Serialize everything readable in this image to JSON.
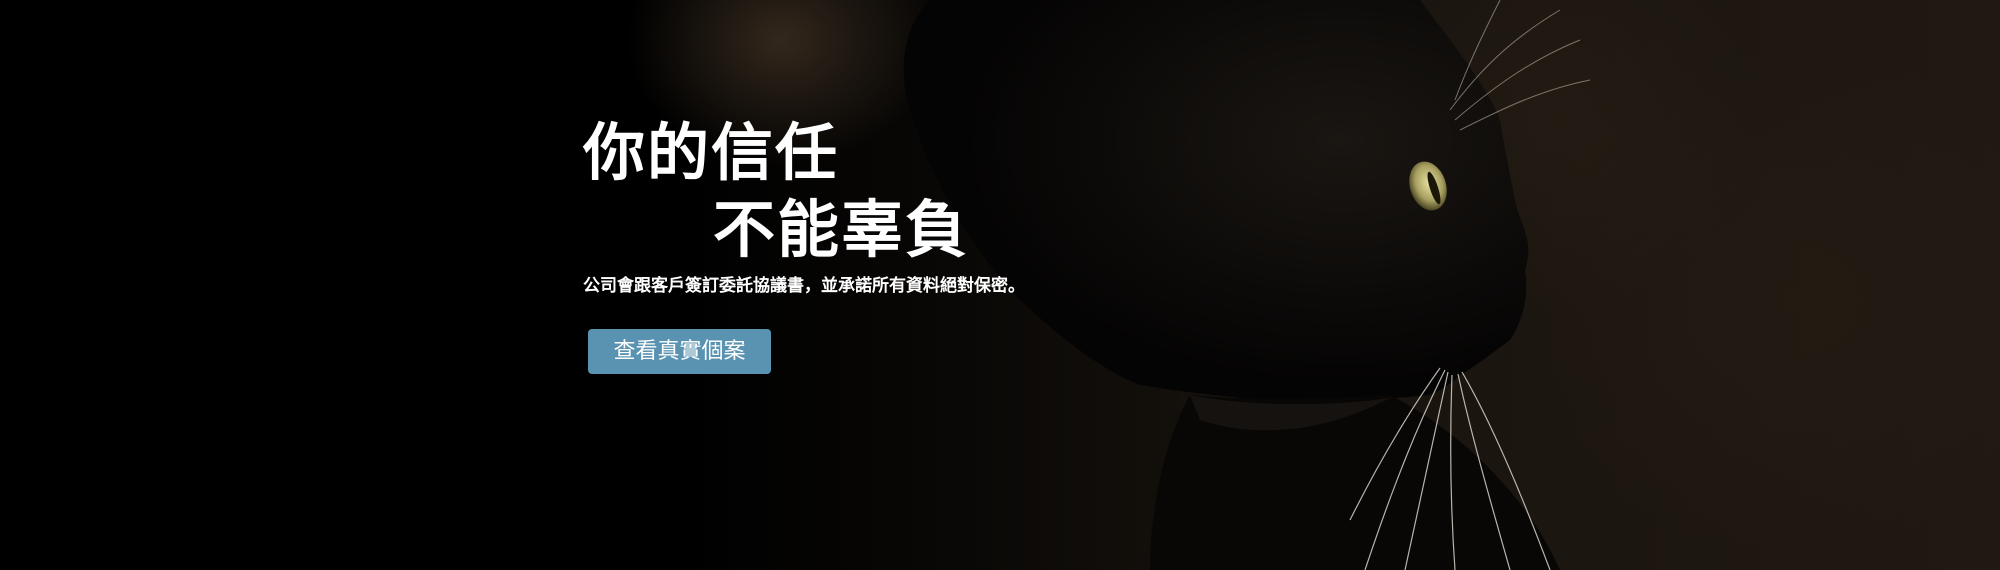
{
  "hero": {
    "headline_line1": "你的信任",
    "headline_line2": "不能辜負",
    "subtitle": "公司會跟客戶簽訂委託協議書，並承諾所有資料絕對保密。",
    "cta_label": "查看真實個案"
  },
  "colors": {
    "background": "#000000",
    "button": "#5a93b2",
    "text": "#ffffff",
    "cat_eye": "#c9c27a"
  },
  "icons": {
    "background_image": "black-cat-photo-icon"
  }
}
